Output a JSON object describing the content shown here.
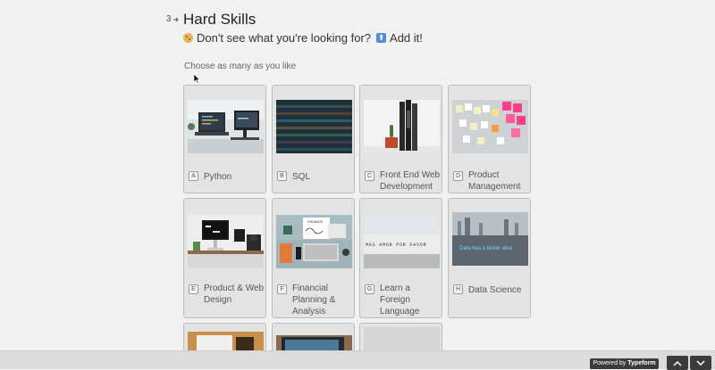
{
  "question": {
    "number": "3",
    "title": "Hard Skills",
    "subtitle_part1": "Don't see what you're looking for?",
    "subtitle_part2": "Add it!",
    "instruction": "Choose as many as you like"
  },
  "choices": [
    {
      "key": "A",
      "label": "Python"
    },
    {
      "key": "B",
      "label": "SQL"
    },
    {
      "key": "C",
      "label": "Front End Web Development"
    },
    {
      "key": "D",
      "label": "Product Management"
    },
    {
      "key": "E",
      "label": "Product & Web Design"
    },
    {
      "key": "F",
      "label": "Financial Planning & Analysis"
    },
    {
      "key": "G",
      "label": "Learn a Foreign Language"
    },
    {
      "key": "H",
      "label": "Data Science"
    }
  ],
  "image_text": {
    "finance_board": "FINANCE",
    "wall_graffiti": "MÁS AMOR POR FAVOR",
    "data_quote": "Data has a better idea"
  },
  "footer": {
    "powered_prefix": "Powered by",
    "powered_brand": "Typeform"
  }
}
